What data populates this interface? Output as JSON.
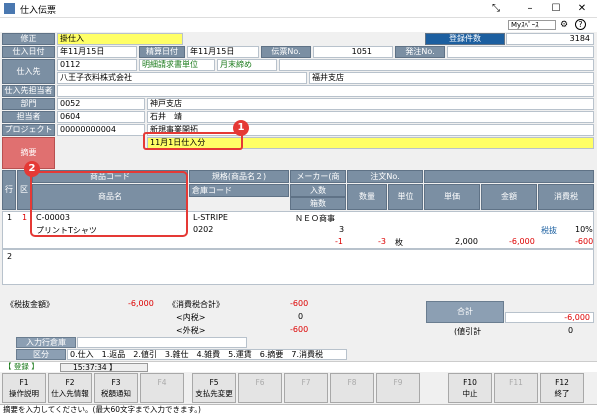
{
  "window": {
    "title": "仕入伝票",
    "myspace": "Myｽﾍﾟｰｽ"
  },
  "header": {
    "mode": "修正",
    "kind": "掛仕入",
    "count_label": "登録件数",
    "count": "3184"
  },
  "fields": {
    "date_label": "仕入日付",
    "date": "年11月15日",
    "settle_label": "精算日付",
    "settle": "年11月15日",
    "slip_label": "伝票No.",
    "slip": "1051",
    "order_label": "発注No.",
    "supplier_label": "仕入先",
    "supplier_code": "0112",
    "supplier_name": "八王子衣料株式会社",
    "unit_label": "明細請求書単位",
    "closing": "月末締め",
    "branch": "福井支店",
    "staff_label": "仕入先担当者",
    "dept_label": "部門",
    "dept_code": "0052",
    "dept_name": "神戸支店",
    "charge_label": "担当者",
    "charge_code": "0604",
    "charge_name": "石井　靖",
    "project_label": "プロジェクト",
    "project_code": "00000000004",
    "project_name": "新規事業開拓",
    "memo_label": "摘要",
    "memo": "11月1日仕入分"
  },
  "grid": {
    "h_row": "行",
    "h_kbn": "区",
    "h_code": "商品コード",
    "h_name": "商品名",
    "h_spec": "規格(商品名２)",
    "h_whcode": "倉庫コード",
    "h_maker": "メーカー(商",
    "h_orderno": "注文No.",
    "h_in": "入数",
    "h_box": "箱数",
    "h_qty": "数量",
    "h_unit": "単位",
    "h_price": "単価",
    "h_amt": "金額",
    "h_tax": "消費税",
    "rows": [
      {
        "no": "1",
        "kbn": "1",
        "code": "C-00003",
        "name": "プリントTシャツ",
        "spec": "L-STRIPE",
        "maker": "ＮＥＯ商事",
        "whcode": "0202",
        "in": "3",
        "box": "-1",
        "qty": "-3",
        "unit": "枚",
        "price": "2,000",
        "amt": "-6,000",
        "taxkind": "税抜",
        "rate": "10%",
        "tax": "-600"
      },
      {
        "no": "2"
      }
    ]
  },
  "totals": {
    "excl_label": "《税抜金額》",
    "excl": "-6,000",
    "tax_label": "《消費税合計》",
    "tax": "-600",
    "in_label": "<内税>",
    "in": "0",
    "out_label": "<外税>",
    "out": "-600",
    "sum_label": "合計",
    "sum": "-6,000",
    "credit_label": "(値引計",
    "credit": "0"
  },
  "wh_label": "入力行倉庫",
  "kbn": {
    "label": "区分",
    "text": "0.仕入　1.返品　2.値引　3.雑仕　4.雑費　5.運賃　6.摘要　7.消費税"
  },
  "status": {
    "mode": "【 登録 】",
    "time": "15:37:34 】"
  },
  "fkeys": [
    {
      "k": "F1",
      "t": "操作説明"
    },
    {
      "k": "F2",
      "t": "仕入先情報"
    },
    {
      "k": "F3",
      "t": "税額通知"
    },
    {
      "k": "F4",
      "t": ""
    },
    {
      "k": "F5",
      "t": "支払先変更"
    },
    {
      "k": "F6",
      "t": ""
    },
    {
      "k": "F7",
      "t": ""
    },
    {
      "k": "F8",
      "t": ""
    },
    {
      "k": "F9",
      "t": ""
    },
    {
      "k": "F10",
      "t": "中止"
    },
    {
      "k": "F11",
      "t": ""
    },
    {
      "k": "F12",
      "t": "終了"
    }
  ],
  "hint": "摘要を入力してください。(最大60文字まで入力できます。)",
  "badges": {
    "b1": "1",
    "b2": "2"
  }
}
